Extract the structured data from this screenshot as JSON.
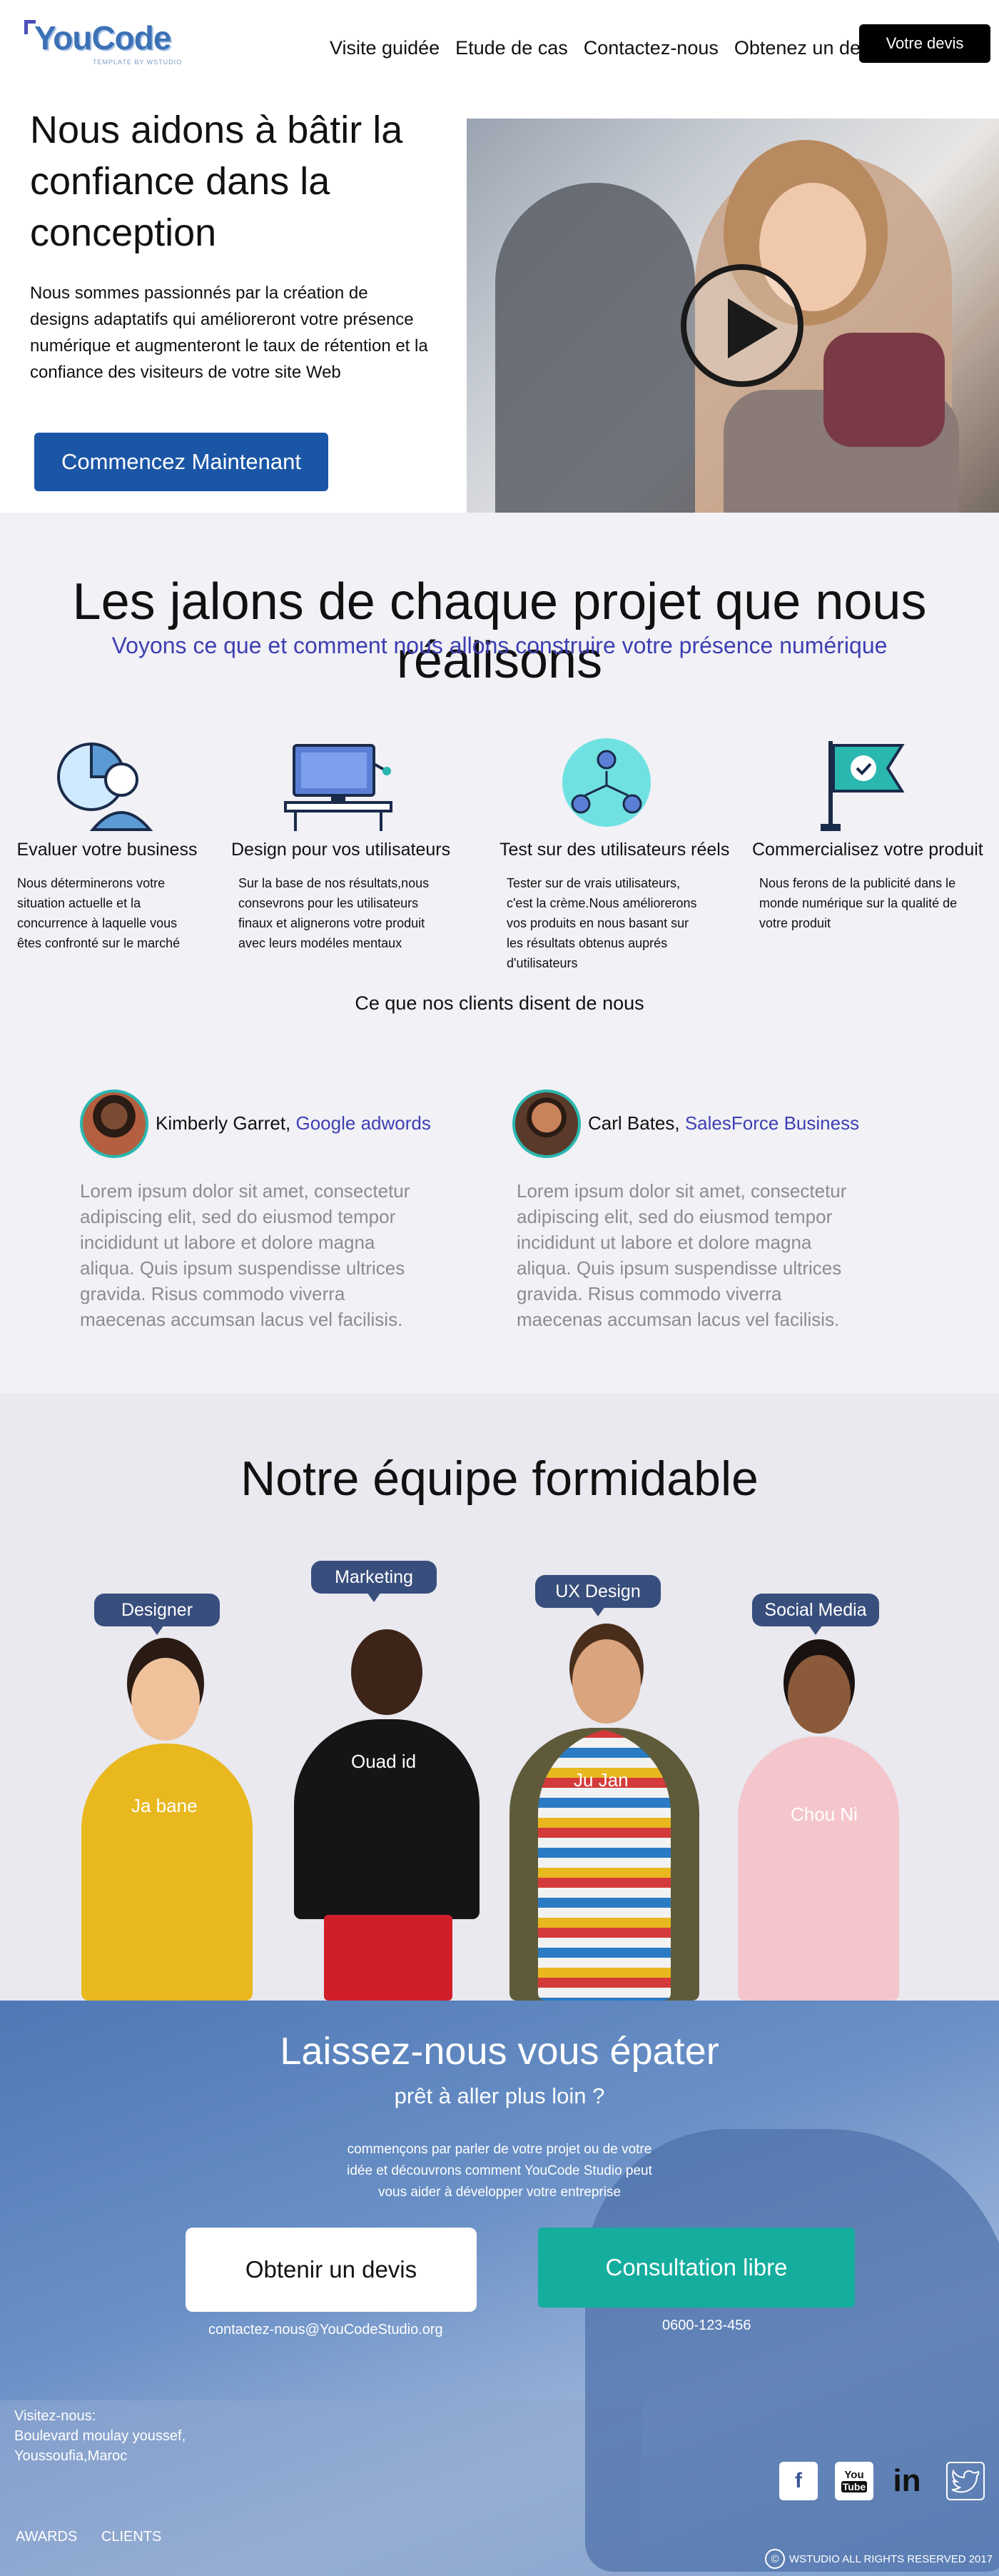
{
  "header": {
    "logo_text": "YouCode",
    "logo_tagline": "TEMPLATE BY WSTUDIO",
    "nav": [
      "Visite guidée",
      "Etude de cas",
      "Contactez-nous",
      "Obtenez un devis"
    ],
    "cta": "Votre devis"
  },
  "hero": {
    "title": "Nous aidons à bâtir la confiance dans la conception",
    "text": "Nous sommes passionnés par la création de designs adaptatifs qui amélioreront votre présence numérique et augmenteront le taux de rétention et la confiance des visiteurs de votre site Web",
    "button": "Commencez Maintenant"
  },
  "milestones": {
    "title": "Les jalons de chaque projet que nous réalisons",
    "subtitle": "Voyons ce que et comment nous allons construire votre présence numérique",
    "steps": [
      {
        "name": "Evaluer votre business",
        "desc": "Nous déterminerons votre situation actuelle et la concurrence à laquelle vous êtes confronté sur le marché"
      },
      {
        "name": "Design pour vos utilisateurs",
        "desc": "Sur la base de nos résultats,nous consevrons pour les utilisateurs finaux et alignerons votre produit avec leurs modéles mentaux"
      },
      {
        "name": "Test sur des utilisateurs réels",
        "desc": "Tester sur de vrais utilisateurs, c'est la crème.Nous améliorerons vos produits en nous basant sur les résultats obtenus auprés d'utilisateurs"
      },
      {
        "name": "Commercialisez votre produit",
        "desc": "Nous ferons de la publicité dans le monde numérique sur la qualité de votre produit"
      }
    ]
  },
  "testimonials": {
    "heading": "Ce que nos clients disent de nous",
    "items": [
      {
        "name": "Kimberly Garret,",
        "company": "Google adwords",
        "text": "Lorem ipsum dolor sit amet, consectetur adipiscing elit, sed do eiusmod tempor incididunt ut labore et dolore magna aliqua. Quis ipsum suspendisse ultrices gravida. Risus commodo viverra maecenas accumsan lacus vel facilisis."
      },
      {
        "name": "Carl Bates,",
        "company": "SalesForce Business",
        "text": "Lorem ipsum dolor sit amet, consectetur adipiscing elit, sed do eiusmod tempor incididunt ut labore et dolore magna aliqua. Quis ipsum suspendisse ultrices gravida. Risus commodo viverra maecenas accumsan lacus vel facilisis."
      }
    ]
  },
  "team": {
    "title": "Notre équipe formidable",
    "members": [
      {
        "role": "Designer",
        "name": "Ja bane"
      },
      {
        "role": "Marketing",
        "name": "Ouad id"
      },
      {
        "role": "UX Design",
        "name": "Ju Jan"
      },
      {
        "role": "Social Media",
        "name": "Chou Ni"
      }
    ]
  },
  "cta": {
    "title": "Laissez-nous vous épater",
    "question": "prêt à aller plus loin ?",
    "intro": "commençons par parler de votre projet ou de votre idée et découvrons comment YouCode Studio peut vous aider à développer votre entreprise",
    "quote_button": "Obtenir un devis",
    "consult_button": "Consultation libre",
    "email": "contactez-nous@YouCodeStudio.org",
    "phone": "0600-123-456",
    "visit_label": "Visitez-nous:",
    "address_line1": "Boulevard moulay youssef,",
    "address_line2": "Youssoufia,Maroc",
    "links": [
      "AWARDS",
      "CLIENTS"
    ],
    "copyright": "WSTUDIO ALL RIGHTS RESERVED 2017",
    "social": [
      "facebook-icon",
      "youtube-icon",
      "linkedin-icon",
      "twitter-icon"
    ]
  },
  "colors": {
    "primary": "#1b56a6",
    "accent_text": "#3e3fb2",
    "teal": "#15ad9e",
    "role_bubble": "#384e7c"
  }
}
